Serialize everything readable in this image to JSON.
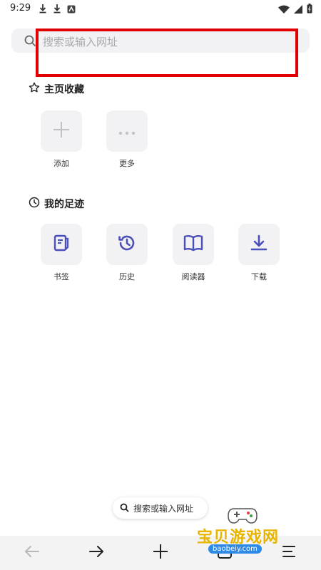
{
  "status_bar": {
    "time": "9:29"
  },
  "search": {
    "placeholder": "搜索或输入网址"
  },
  "favorites": {
    "title": "主页收藏",
    "items": [
      {
        "label": "添加",
        "icon": "plus-icon"
      },
      {
        "label": "更多",
        "icon": "more-dots-icon"
      }
    ]
  },
  "footprints": {
    "title": "我的足迹",
    "items": [
      {
        "label": "书签",
        "icon": "bookmark-icon"
      },
      {
        "label": "历史",
        "icon": "history-icon"
      },
      {
        "label": "阅读器",
        "icon": "book-icon"
      },
      {
        "label": "下载",
        "icon": "download-icon"
      }
    ]
  },
  "floating_search": {
    "label": "搜索或输入网址"
  },
  "toolbar": {
    "buttons": [
      "back-arrow-icon",
      "forward-arrow-icon",
      "plus-icon",
      "tabs-icon",
      "menu-icon"
    ]
  },
  "watermark": {
    "text": "宝贝游戏网",
    "url": "baobeiy.com"
  },
  "colors": {
    "accent": "#4b4fb8",
    "highlight": "#e00000",
    "tile_bg": "#f2f2f5"
  }
}
